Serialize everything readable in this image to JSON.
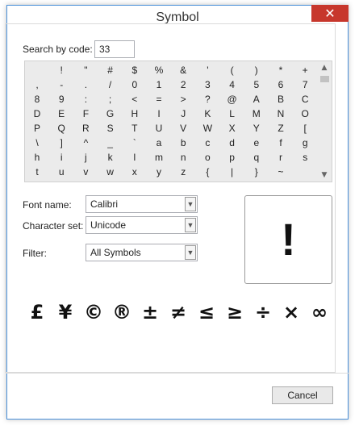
{
  "window": {
    "title": "Symbol",
    "close_glyph": "✕"
  },
  "search": {
    "label": "Search by code:",
    "value": "33"
  },
  "grid": {
    "rows": [
      [
        " ",
        "!",
        "\"",
        "#",
        "$",
        "%",
        "&",
        "'",
        "(",
        ")",
        "*",
        "+"
      ],
      [
        ",",
        "-",
        ".",
        "/",
        "0",
        "1",
        "2",
        "3",
        "4",
        "5",
        "6",
        "7"
      ],
      [
        "8",
        "9",
        ":",
        ";",
        "<",
        "=",
        ">",
        "?",
        "@",
        "A",
        "B",
        "C"
      ],
      [
        "D",
        "E",
        "F",
        "G",
        "H",
        "I",
        "J",
        "K",
        "L",
        "M",
        "N",
        "O"
      ],
      [
        "P",
        "Q",
        "R",
        "S",
        "T",
        "U",
        "V",
        "W",
        "X",
        "Y",
        "Z",
        "["
      ],
      [
        "\\",
        "]",
        "^",
        "_",
        "`",
        "a",
        "b",
        "c",
        "d",
        "e",
        "f",
        "g"
      ],
      [
        "h",
        "i",
        "j",
        "k",
        "l",
        "m",
        "n",
        "o",
        "p",
        "q",
        "r",
        "s"
      ],
      [
        "t",
        "u",
        "v",
        "w",
        "x",
        "y",
        "z",
        "{",
        "|",
        "}",
        "~",
        ""
      ]
    ]
  },
  "scrollbar": {
    "up_icon": "up-arrow",
    "down_icon": "down-arrow"
  },
  "font": {
    "label": "Font name:",
    "value": "Calibri"
  },
  "charset": {
    "label": "Character set:",
    "value": "Unicode"
  },
  "filter": {
    "label": "Filter:",
    "value": "All Symbols"
  },
  "preview": {
    "symbol": "!"
  },
  "quick_symbols": [
    "£",
    "¥",
    "©",
    "®",
    "±",
    "≠",
    "≤",
    "≥",
    "÷",
    "×",
    "∞"
  ],
  "buttons": {
    "cancel": "Cancel"
  },
  "colors": {
    "accent": "#4a90d9",
    "close_bg": "#c7372c",
    "grid_bg": "#ebebeb"
  }
}
